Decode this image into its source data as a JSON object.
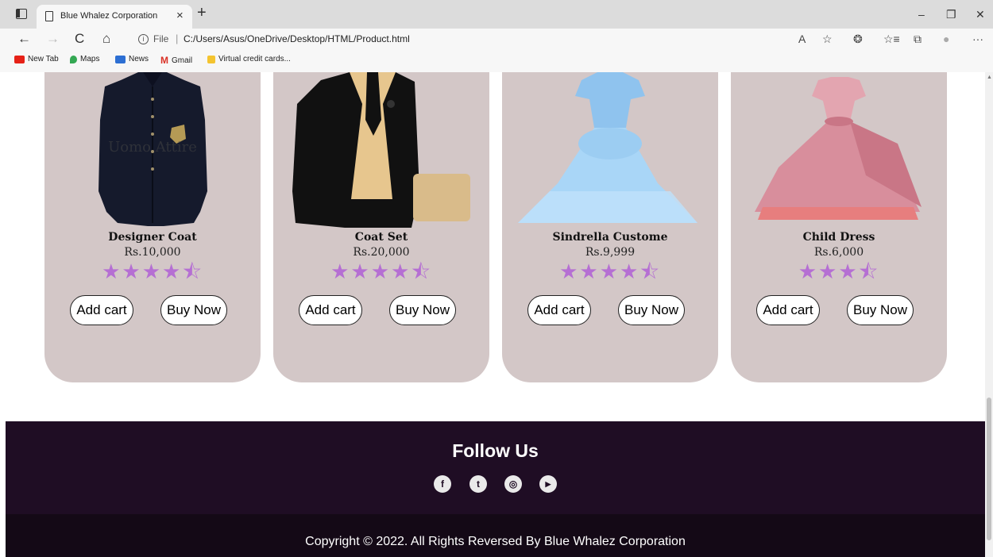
{
  "browser": {
    "tab_title": "Blue Whalez Corporation",
    "tab_close": "×",
    "new_tab": "+",
    "window_controls": {
      "minimize": "–",
      "restore": "❐",
      "close": "✕"
    },
    "nav": {
      "back": "←",
      "forward": "→",
      "refresh": "C",
      "home": "⌂"
    },
    "file_label": "File",
    "separator": "|",
    "url": "C:/Users/Asus/OneDrive/Desktop/HTML/Product.html",
    "toolbar_icons": {
      "read_aloud": "A",
      "favorite_add": "☆",
      "extensions": "❂",
      "favorites": "☆≡",
      "collections": "⧉",
      "profile": "●",
      "more": "···"
    }
  },
  "bookmarks": [
    {
      "label": "New Tab",
      "icon": "youtube-icon",
      "color": "#e62117"
    },
    {
      "label": "Maps",
      "icon": "maps-icon",
      "color": "#34a853"
    },
    {
      "label": "News",
      "icon": "news-icon",
      "color": "#2d6fd3"
    },
    {
      "label": "Gmail",
      "icon": "gmail-icon",
      "color": "#d93025"
    },
    {
      "label": "Virtual credit cards...",
      "icon": "card-icon",
      "color": "#f4c430"
    }
  ],
  "products": [
    {
      "name": "Designer Coat",
      "price": "Rs.10,000",
      "rating": 4.5,
      "add_cart": "Add cart",
      "buy_now": "Buy Now",
      "image": "black-designer-coat",
      "watermark": "Uomo Attire"
    },
    {
      "name": "Coat Set",
      "price": "Rs.20,000",
      "rating": 4.5,
      "add_cart": "Add cart",
      "buy_now": "Buy Now",
      "image": "black-gold-coat-set"
    },
    {
      "name": "Sindrella Custome",
      "price": "Rs.9,999",
      "rating": 4.5,
      "add_cart": "Add cart",
      "buy_now": "Buy Now",
      "image": "blue-princess-dress"
    },
    {
      "name": "Child Dress",
      "price": "Rs.6,000",
      "rating": 3.5,
      "add_cart": "Add cart",
      "buy_now": "Buy Now",
      "image": "pink-child-dress"
    }
  ],
  "footer": {
    "follow_title": "Follow Us",
    "social": [
      {
        "name": "facebook-icon",
        "glyph": "f"
      },
      {
        "name": "twitter-icon",
        "glyph": "t"
      },
      {
        "name": "instagram-icon",
        "glyph": "◎"
      },
      {
        "name": "youtube-icon",
        "glyph": "▶"
      }
    ],
    "copyright": "Copyright © 2022. All Rights Reversed By Blue Whalez Corporation"
  },
  "colors": {
    "card_bg": "#d3c7c7",
    "star": "#b56fd3",
    "footer_bg": "#1f0d24",
    "copyright_bg": "#140916"
  }
}
